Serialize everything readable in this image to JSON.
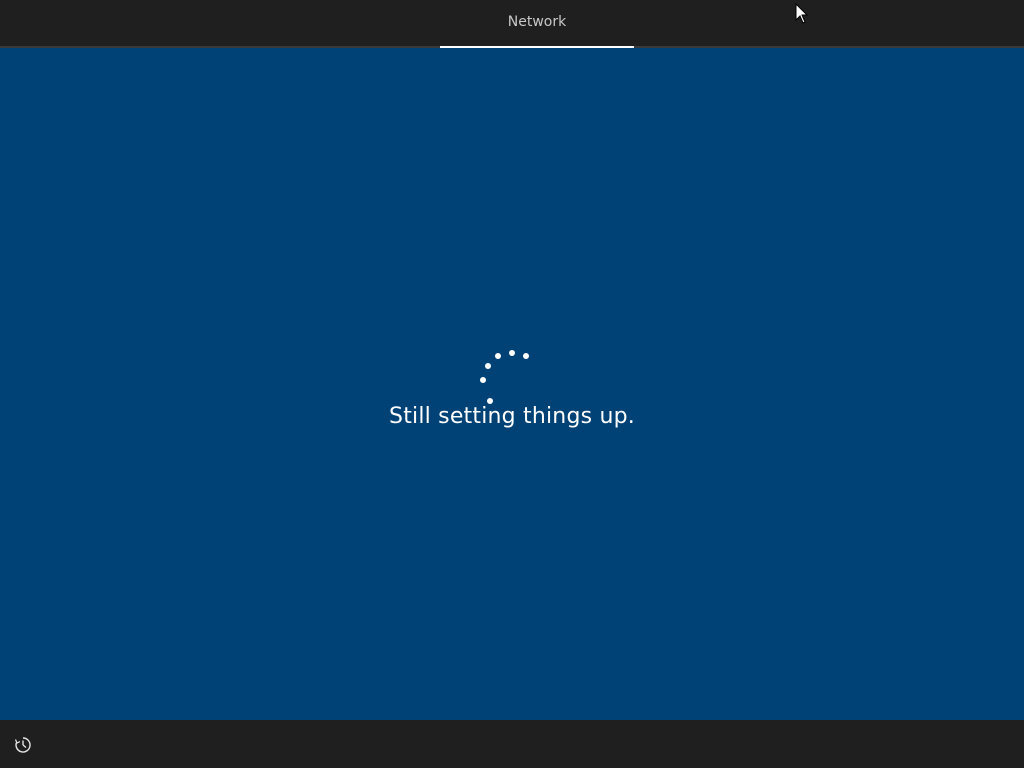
{
  "header": {
    "tab_label": "Network"
  },
  "main": {
    "status_text": "Still setting things up.",
    "spinner_icon": "loading-dots-icon"
  },
  "footer": {
    "ease_of_access_icon": "ease-of-access-icon"
  },
  "colors": {
    "background": "#004275",
    "bar": "#1f1f1f",
    "text": "#ffffff",
    "tab_text": "#c8c8c8"
  }
}
